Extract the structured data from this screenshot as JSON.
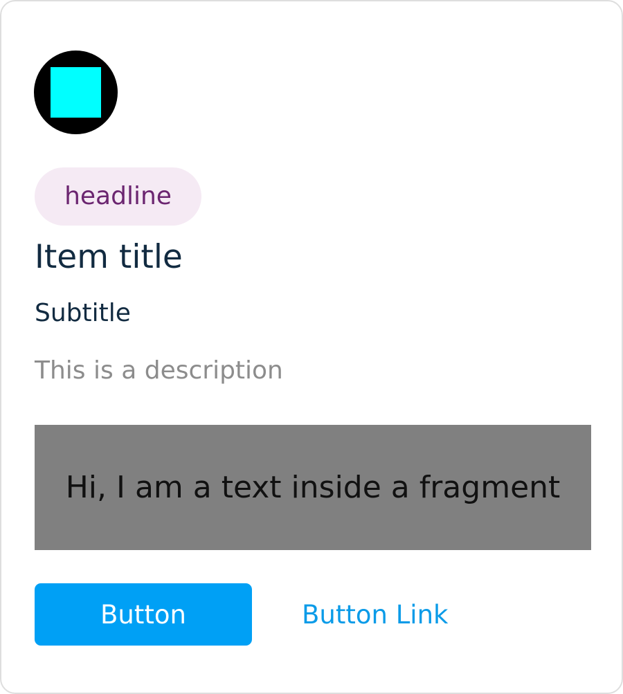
{
  "colors": {
    "card_border": "#dedede",
    "avatar_background": "#000000",
    "avatar_square": "#00ffff",
    "chip_background": "#f5eaf4",
    "chip_text": "#6b2570",
    "title_text": "#122b41",
    "description_text": "#8c8c8c",
    "fragment_background": "#808080",
    "button_background": "#00a0f5",
    "button_text": "#ffffff",
    "link_text": "#0a9be8"
  },
  "card": {
    "avatar_icon": "square-avatar-icon",
    "headline": "headline",
    "title": "Item title",
    "subtitle": "Subtitle",
    "description": "This is a description",
    "fragment_text": "Hi, I am a text inside a fragment",
    "button_label": "Button",
    "link_label": "Button Link"
  }
}
